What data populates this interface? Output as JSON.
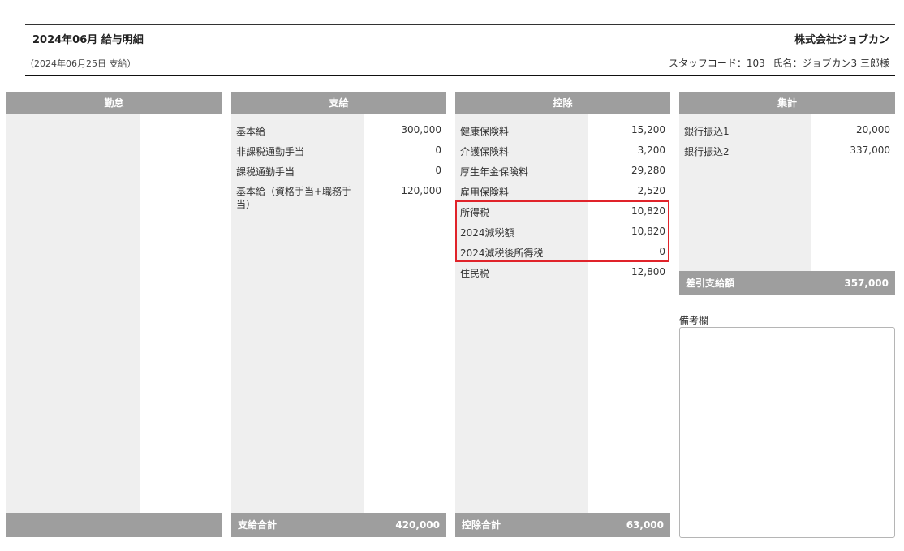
{
  "header": {
    "title": "2024年06月 給与明細",
    "company": "株式会社ジョブカン",
    "pay_date": "（2024年06月25日 支給）",
    "staff_code_label": "スタッフコード：103",
    "staff_name_label": "氏名：ジョブカン3 三郎様"
  },
  "attendance": {
    "title": "勤怠"
  },
  "payments": {
    "title": "支給",
    "items": [
      {
        "label": "基本給",
        "value": "300,000"
      },
      {
        "label": "非課税通勤手当",
        "value": "0"
      },
      {
        "label": "課税通勤手当",
        "value": "0"
      },
      {
        "label_line1": "基本給（資格手当+職務手",
        "label_line2": "当）",
        "value": "120,000"
      }
    ],
    "total_label": "支給合計",
    "total_value": "420,000"
  },
  "deductions": {
    "title": "控除",
    "items": [
      {
        "label": "健康保険料",
        "value": "15,200"
      },
      {
        "label": "介護保険料",
        "value": "3,200"
      },
      {
        "label": "厚生年金保険料",
        "value": "29,280"
      },
      {
        "label": "雇用保険料",
        "value": "2,520"
      },
      {
        "label": "所得税",
        "value": "10,820"
      },
      {
        "label": "2024減税額",
        "value": "10,820"
      },
      {
        "label": "2024減税後所得税",
        "value": "0"
      },
      {
        "label": "住民税",
        "value": "12,800"
      }
    ],
    "total_label": "控除合計",
    "total_value": "63,000"
  },
  "summary": {
    "title": "集計",
    "items": [
      {
        "label": "銀行振込1",
        "value": "20,000"
      },
      {
        "label": "銀行振込2",
        "value": "337,000"
      }
    ],
    "net_label": "差引支給額",
    "net_value": "357,000"
  },
  "remarks": {
    "label": "備考欄"
  },
  "colors": {
    "panel_header": "#9e9e9e",
    "panel_shade": "#efefef",
    "highlight": "#e0232a"
  }
}
